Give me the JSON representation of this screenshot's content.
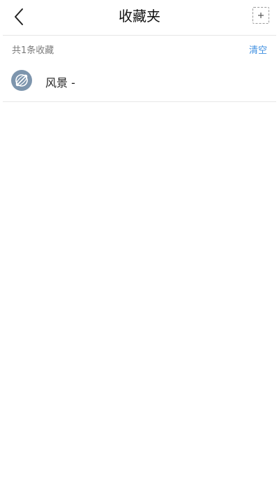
{
  "header": {
    "title": "收藏夹",
    "back_icon": "chevron-left-icon",
    "add_icon": "plus-icon"
  },
  "summary": {
    "count_text": "共1条收藏",
    "clear_label": "清空"
  },
  "favorites": [
    {
      "icon": "globe-icon",
      "label": "风景 -"
    }
  ],
  "colors": {
    "accent": "#3f8fe0",
    "icon_bg": "#7d95ad",
    "divider": "#e6e6e6"
  }
}
